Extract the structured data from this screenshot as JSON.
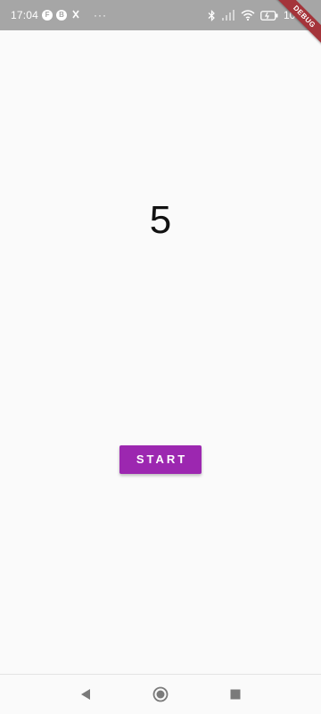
{
  "status_bar": {
    "time": "17:04",
    "battery_text": "100",
    "left_icons": [
      "notification-icon",
      "notification-icon",
      "sync-icon"
    ],
    "overflow": "···"
  },
  "ribbon": {
    "label": "DEBUG"
  },
  "main": {
    "counter": "5",
    "start_label": "START"
  },
  "colors": {
    "status_bar": "#a6a6a6",
    "background": "#fafafa",
    "button": "#9c27b0",
    "ribbon": "#a4343a"
  }
}
